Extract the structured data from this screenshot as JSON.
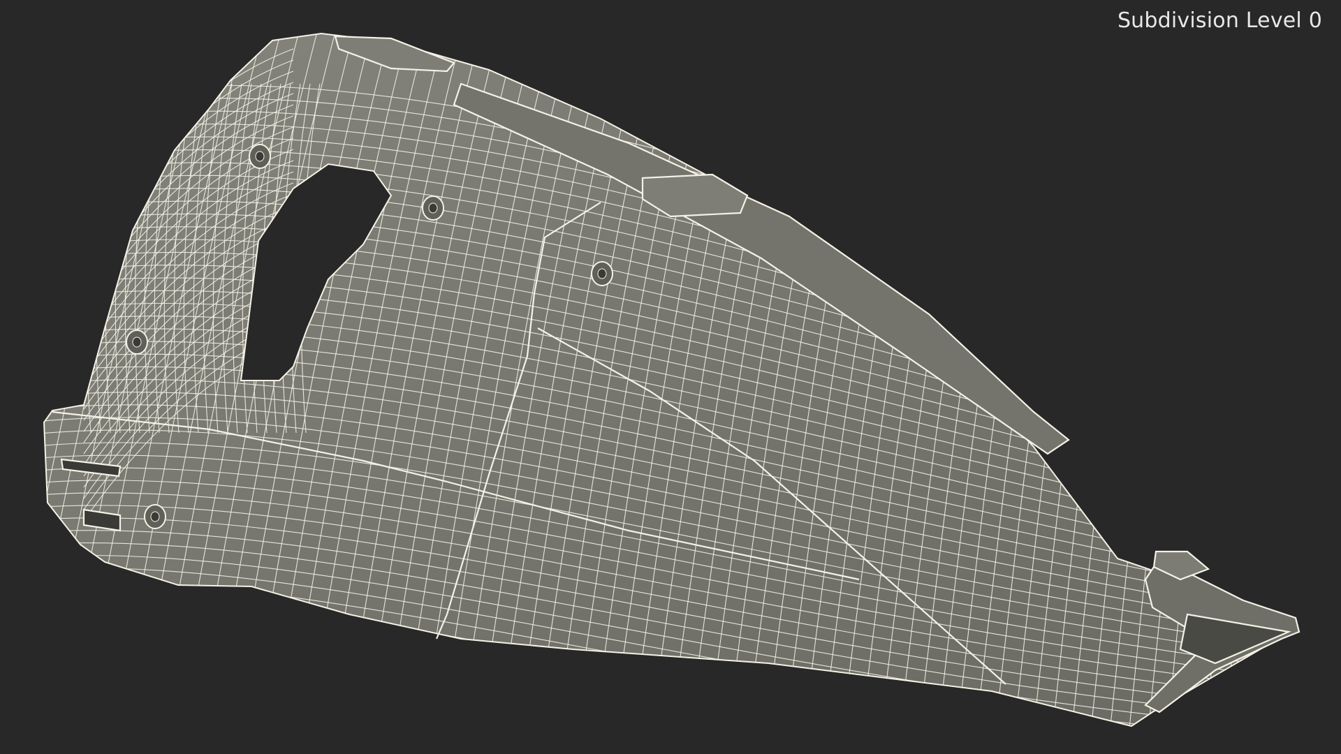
{
  "overlay": {
    "label": "Subdivision Level 0"
  },
  "scene": {
    "subject": "handheld-vacuum-wireframe-model",
    "background_color": "#282828",
    "surface_color": "#74746c",
    "wire_color": "#f4f2e6"
  }
}
